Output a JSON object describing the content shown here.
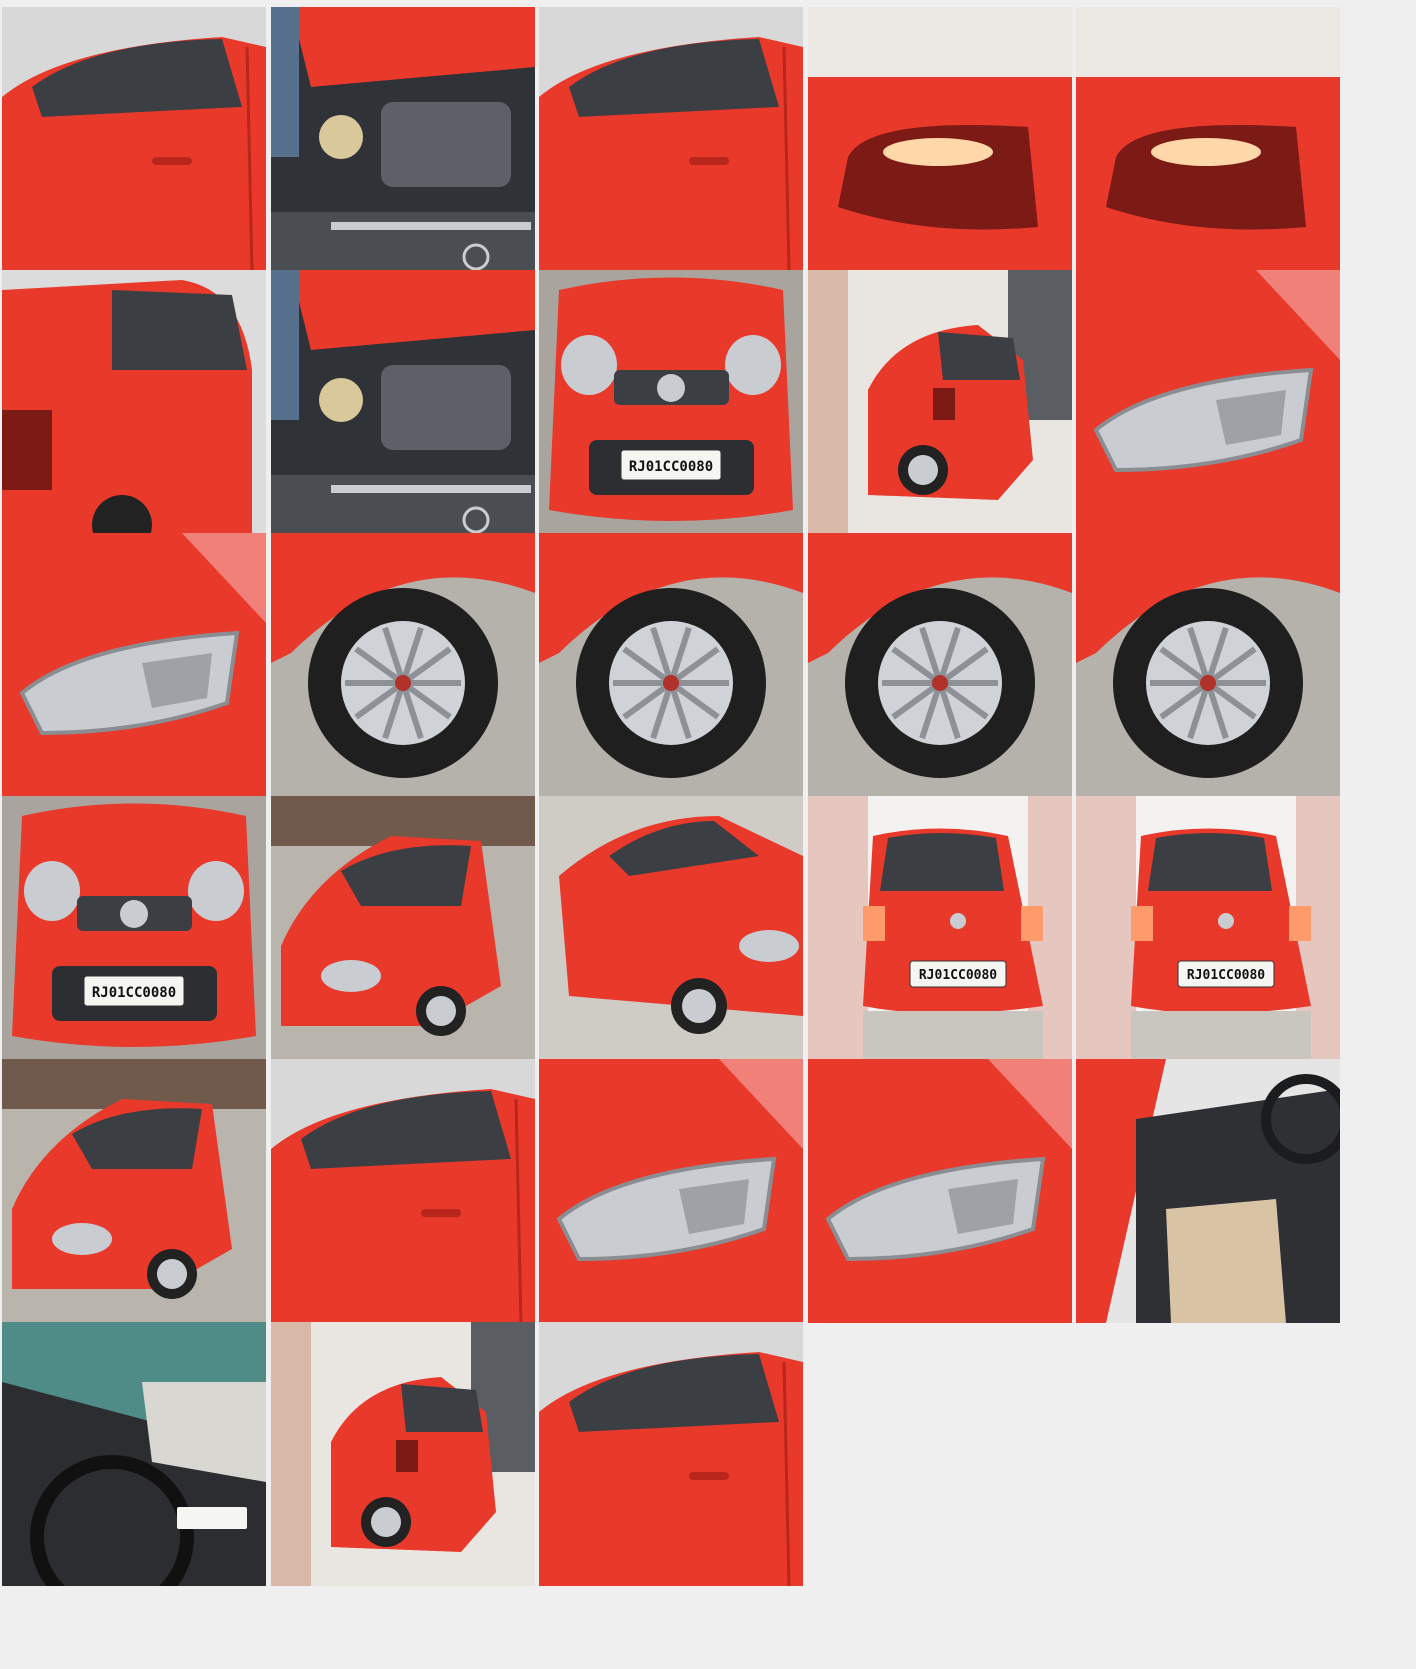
{
  "gallery": {
    "columns": 5,
    "photos": [
      {
        "subject": "door-side",
        "plate": ""
      },
      {
        "subject": "engine",
        "plate": ""
      },
      {
        "subject": "door-side",
        "plate": ""
      },
      {
        "subject": "taillight",
        "plate": ""
      },
      {
        "subject": "taillight",
        "plate": ""
      },
      {
        "subject": "rear-quarter",
        "plate": ""
      },
      {
        "subject": "engine",
        "plate": ""
      },
      {
        "subject": "front",
        "plate": "RJ01CC0080"
      },
      {
        "subject": "rear-three-quarter",
        "plate": ""
      },
      {
        "subject": "headlight",
        "plate": ""
      },
      {
        "subject": "headlight",
        "plate": ""
      },
      {
        "subject": "wheel",
        "plate": ""
      },
      {
        "subject": "wheel",
        "plate": ""
      },
      {
        "subject": "wheel",
        "plate": ""
      },
      {
        "subject": "wheel",
        "plate": ""
      },
      {
        "subject": "front",
        "plate": "RJ01CC0080"
      },
      {
        "subject": "front-three-quarter",
        "plate": ""
      },
      {
        "subject": "side-three-quarter",
        "plate": ""
      },
      {
        "subject": "rear",
        "plate": "RJ01CC0080"
      },
      {
        "subject": "rear",
        "plate": "RJ01CC0080"
      },
      {
        "subject": "front-three-quarter",
        "plate": ""
      },
      {
        "subject": "door-side",
        "plate": ""
      },
      {
        "subject": "headlight",
        "plate": ""
      },
      {
        "subject": "headlight",
        "plate": ""
      },
      {
        "subject": "interior",
        "plate": ""
      },
      {
        "subject": "dashboard",
        "plate": ""
      },
      {
        "subject": "rear-three-quarter",
        "plate": ""
      },
      {
        "subject": "door-side",
        "plate": ""
      }
    ]
  },
  "colors": {
    "body_red": "#e8392b",
    "body_red_dark": "#b9261b",
    "background": "#efefef",
    "floor": "#b5b2ab",
    "chrome": "#c9ccd0"
  }
}
